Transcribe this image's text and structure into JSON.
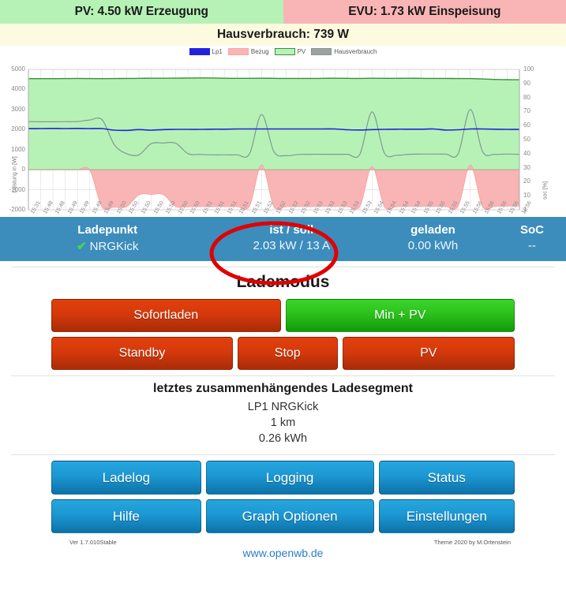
{
  "header": {
    "pv": "PV: 4.50 kW Erzeugung",
    "evu": "EVU: 1.73 kW Einspeisung",
    "house": "Hausverbrauch: 739 W",
    "pv_color": "#b6f2b6",
    "evu_color": "#f9b5b5",
    "house_color": "#fcfbe0"
  },
  "chart_data": {
    "type": "area",
    "title": "",
    "xlabel": "",
    "ylabel": "Leistung in [W]",
    "y2label": "soc [%]",
    "ylim": [
      -2000,
      5000
    ],
    "y2lim": [
      1,
      100
    ],
    "grid": true,
    "legend_position": "top-center",
    "yticks": [
      "5000",
      "4000",
      "3000",
      "2000",
      "1000",
      "0",
      "-1000",
      "-2000"
    ],
    "y2ticks": [
      "100",
      "90",
      "80",
      "70",
      "60",
      "50",
      "40",
      "30",
      "20",
      "10",
      "1"
    ],
    "xticks": [
      "15:31",
      "15:48",
      "15:48",
      "15:49",
      "15:49",
      "15:49",
      "15:49",
      "15:50",
      "15:50",
      "15:50",
      "15:50",
      "15:50",
      "15:50",
      "15:50",
      "15:51",
      "15:51",
      "15:51",
      "15:51",
      "15:51",
      "15:52",
      "15:52",
      "15:52",
      "15:52",
      "15:53",
      "15:53",
      "15:53",
      "15:53",
      "15:53",
      "15:54",
      "15:54",
      "15:54",
      "15:54",
      "15:55",
      "15:55",
      "15:55",
      "15:55",
      "15:56",
      "15:56",
      "15:56",
      "15:56",
      "15:56"
    ],
    "series": [
      {
        "name": "Lp1",
        "color": "#2222dd",
        "fill": "#2222dd",
        "kind": "line",
        "values": [
          2050,
          2050,
          2060,
          2050,
          2060,
          2050,
          2050,
          1970,
          1960,
          2000,
          1970,
          2000,
          2010,
          2010,
          2010,
          2020,
          2020,
          2030,
          2030,
          2030,
          2030,
          2030,
          2030,
          2030,
          2030,
          2030,
          1990,
          1980,
          2000,
          2010,
          2020,
          2020,
          2020,
          2030,
          1980,
          1990,
          2030,
          2030,
          2020,
          2010,
          2010
        ]
      },
      {
        "name": "Bezug",
        "color": "#f9a6a6",
        "fill": "#f9b5b5",
        "kind": "area",
        "values": [
          0,
          0,
          0,
          0,
          0,
          -20,
          -1850,
          -1860,
          -1840,
          -1250,
          -1230,
          -1240,
          -1830,
          -1840,
          -1830,
          -1830,
          -1830,
          -1830,
          -1820,
          240,
          -1830,
          -1830,
          -1830,
          -1830,
          -1820,
          -1820,
          -1830,
          -1820,
          160,
          -1830,
          -1830,
          -1820,
          -1820,
          -1820,
          -1830,
          -1820,
          230,
          -1830,
          -1820,
          -1810,
          -1810
        ]
      },
      {
        "name": "PV",
        "color": "#3a8f3a",
        "fill": "#b6f2b6",
        "kind": "area",
        "values": [
          4540,
          4540,
          4540,
          4545,
          4550,
          4545,
          4540,
          4545,
          4550,
          4555,
          4560,
          4560,
          4565,
          4570,
          4575,
          4570,
          4560,
          4555,
          4555,
          4560,
          4555,
          4550,
          4550,
          4550,
          4555,
          4560,
          4555,
          4550,
          4560,
          4555,
          4555,
          4560,
          4555,
          4550,
          4550,
          4545,
          4545,
          4525,
          4500,
          4490,
          4485
        ]
      },
      {
        "name": "Hausverbrauch",
        "color": "#7f9a8f",
        "fill": "#a0a0a0",
        "kind": "line",
        "values": [
          2400,
          2390,
          2390,
          2395,
          2400,
          2480,
          2490,
          1250,
          800,
          740,
          1300,
          1330,
          1320,
          800,
          760,
          740,
          740,
          740,
          780,
          2750,
          900,
          700,
          760,
          770,
          770,
          770,
          770,
          770,
          2880,
          830,
          720,
          770,
          780,
          780,
          780,
          790,
          3000,
          900,
          770,
          780,
          770
        ]
      }
    ]
  },
  "table": {
    "columns": [
      "Ladepunkt",
      "ist / soll",
      "geladen",
      "SoC"
    ],
    "row": {
      "check_icon": "check-icon",
      "name": "NRGKick",
      "ist_soll": "2.03 kW / 13 A",
      "geladen": "0.00 kWh",
      "soc": "--"
    }
  },
  "lademodus": {
    "title": "Lademodus",
    "buttons": [
      {
        "label": "Sofortladen",
        "state": "inactive",
        "color": "#d5390b"
      },
      {
        "label": "Min + PV",
        "state": "active",
        "color": "#2bc11c"
      },
      {
        "label": "Standby",
        "state": "inactive",
        "color": "#d5390b"
      },
      {
        "label": "Stop",
        "state": "inactive",
        "color": "#d5390b"
      },
      {
        "label": "PV",
        "state": "inactive",
        "color": "#d5390b"
      }
    ]
  },
  "segment": {
    "title": "letztes zusammenhängendes Ladesegment",
    "line1": "LP1 NRGKick",
    "line2": "1 km",
    "line3": "0.26 kWh"
  },
  "nav": {
    "buttons": [
      "Ladelog",
      "Logging",
      "Status",
      "Hilfe",
      "Graph Optionen",
      "Einstellungen"
    ]
  },
  "footer": {
    "version": "Ver 1.7.010Stable",
    "site": "www.openwb.de",
    "theme": "Theme 2020 by M.Ortenstein"
  },
  "annotation": {
    "shape": "ellipse",
    "color": "#e00000",
    "target": "ist / soll"
  }
}
